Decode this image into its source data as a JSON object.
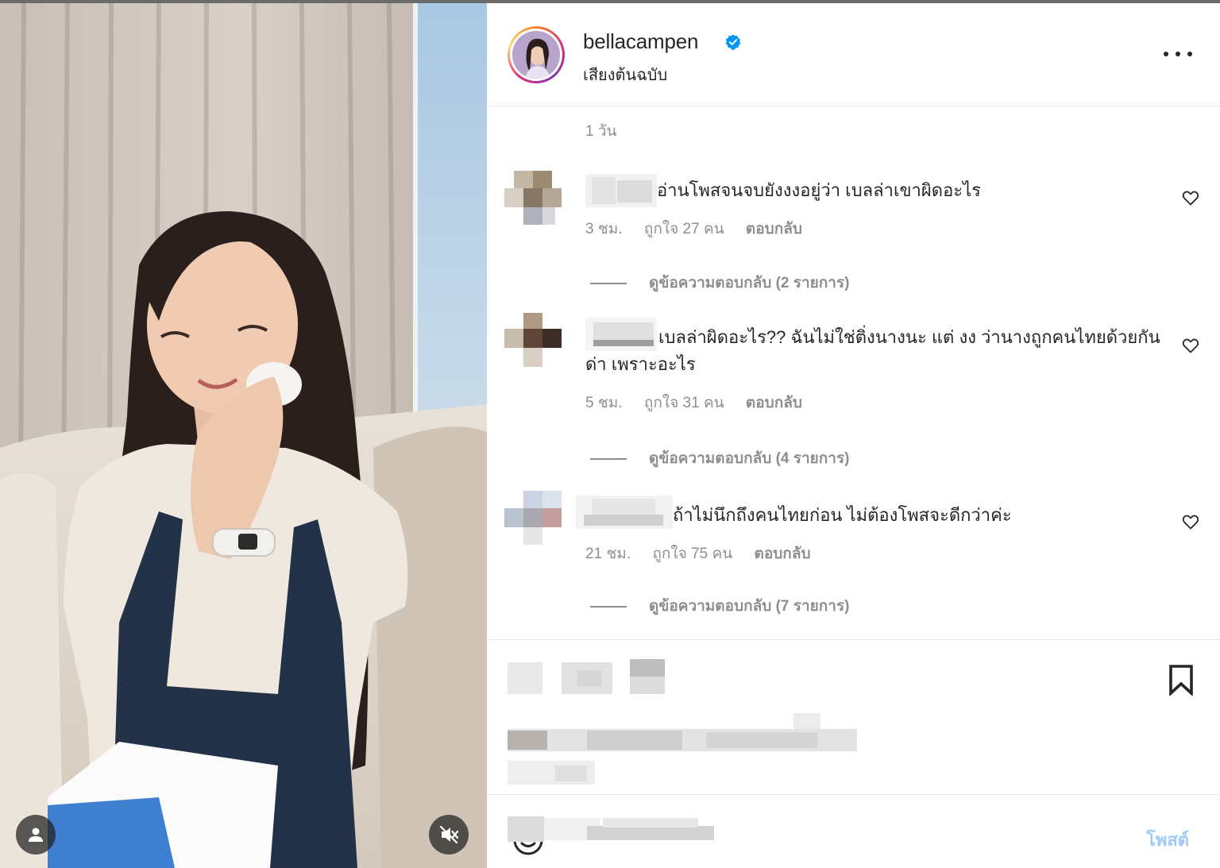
{
  "post": {
    "username": "bellacampen",
    "audio_label": "เสียงต้นฉบับ",
    "age": "1 วัน"
  },
  "comments": [
    {
      "text": "อ่านโพสจนจบยังงงอยู่ว่า เบลล่าเขาผิดอะไร",
      "time": "3 ชม.",
      "likes": "ถูกใจ 27 คน",
      "reply_label": "ตอบกลับ",
      "view_replies": "ดูข้อความตอบกลับ (2 รายการ)"
    },
    {
      "text": "เบลล่าผิดอะไร?? ฉันไม่ใช่ติ่งนางนะ แต่ งง ว่านางถูกคนไทยด้วยกันด่า เพราะอะไร",
      "time": "5 ชม.",
      "likes": "ถูกใจ 31 คน",
      "reply_label": "ตอบกลับ",
      "view_replies": "ดูข้อความตอบกลับ (4 รายการ)"
    },
    {
      "text": "ถ้าไม่นึกถึงคนไทยก่อน ไม่ต้องโพสจะดีกว่าค่ะ",
      "time": "21 ชม.",
      "likes": "ถูกใจ 75 คน",
      "reply_label": "ตอบกลับ",
      "view_replies": "ดูข้อความตอบกลับ (7 รายการ)"
    }
  ],
  "composer": {
    "post_label": "โพสต์"
  },
  "icons": {
    "verified": "verified-badge-icon",
    "more": "more-options-icon",
    "like": "heart-icon",
    "bookmark": "bookmark-icon",
    "tag": "user-tag-icon",
    "mute": "muted-speaker-icon",
    "emoji": "emoji-icon"
  },
  "colors": {
    "verified_blue": "#0095f6",
    "secondary_text": "#8e8e8e",
    "post_button_disabled": "#9dcaf6"
  }
}
